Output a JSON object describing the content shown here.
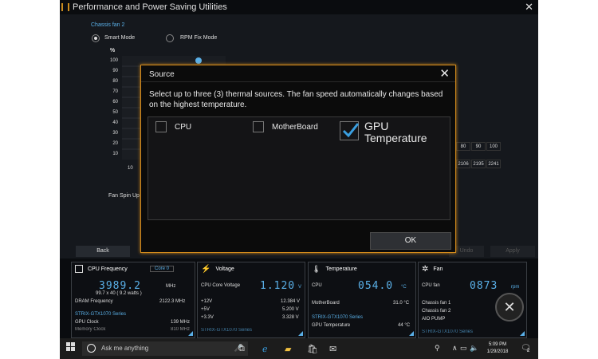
{
  "window": {
    "title": "Performance and Power Saving Utilities",
    "close": "✕"
  },
  "fan_section": {
    "label": "Chassis fan 2",
    "modes": [
      {
        "label": "Smart Mode",
        "selected": true
      },
      {
        "label": "RPM Fix Mode",
        "selected": false
      }
    ],
    "y_unit": "%",
    "y_ticks": [
      "100",
      "90",
      "80",
      "70",
      "60",
      "50",
      "40",
      "30",
      "20",
      "10"
    ],
    "x_label": "10",
    "table_top": [
      "80",
      "90",
      "100"
    ],
    "table_bottom": [
      "2106",
      "2195",
      "2241"
    ],
    "spin_up_label": "Fan Spin Up",
    "back_button": "Back",
    "dim_buttons": [
      "Undo",
      "Apply"
    ]
  },
  "modal": {
    "title": "Source",
    "close": "✕",
    "description": "Select up to three (3) thermal sources. The fan speed automatically changes based on the highest temperature.",
    "options": [
      {
        "label": "CPU",
        "checked": false
      },
      {
        "label": "MotherBoard",
        "checked": false
      },
      {
        "label": "GPU Temperature",
        "checked": true
      }
    ],
    "ok_button": "OK",
    "check_color": "#3a9fe0",
    "border_color": "#d28a1c"
  },
  "dashboard": {
    "cpu": {
      "title": "CPU Frequency",
      "core_select": "Core 0",
      "freq": "3989.2",
      "freq_unit": "MHz",
      "detail": "99.7  x  40   ( 9.2  watts )",
      "dram_label": "DRAM Frequency",
      "dram_value": "2122.3  MHz",
      "gpu_name": "STRIX-GTX1070 Series",
      "gpu_clock_label": "GPU Clock",
      "gpu_clock_value": "139 MHz",
      "mem_clock_label": "Memory Clock",
      "mem_clock_value": "810 MHz"
    },
    "voltage": {
      "title": "Voltage",
      "core_label": "CPU Core Voltage",
      "core_value": "1.120",
      "core_unit": "V",
      "rows": [
        {
          "label": "+12V",
          "value": "12.384  V"
        },
        {
          "label": "+5V",
          "value": "5.200  V"
        },
        {
          "label": "+3.3V",
          "value": "3.328  V"
        }
      ],
      "gpu_name": "STRIX-GTX1070 Series"
    },
    "temperature": {
      "title": "Temperature",
      "cpu_label": "CPU",
      "cpu_value": "054.0",
      "cpu_unit": "°C",
      "mb_label": "MotherBoard",
      "mb_value": "31.0 °C",
      "gpu_name": "STRIX-GTX1070 Series",
      "gpu_label": "GPU Temperature",
      "gpu_value": "44 °C"
    },
    "fan": {
      "title": "Fan",
      "cpu_label": "CPU fan",
      "cpu_value": "0873",
      "cpu_unit": "rpm",
      "rows": [
        "Chassis fan 1",
        "Chassis fan 2",
        "AIO PUMP"
      ],
      "gpu_name": "STRIX-GTX1070 Series"
    }
  },
  "taskbar": {
    "search_placeholder": "Ask me anything",
    "time": "5:09 PM",
    "date": "1/29/2018",
    "notification_count": "2"
  }
}
